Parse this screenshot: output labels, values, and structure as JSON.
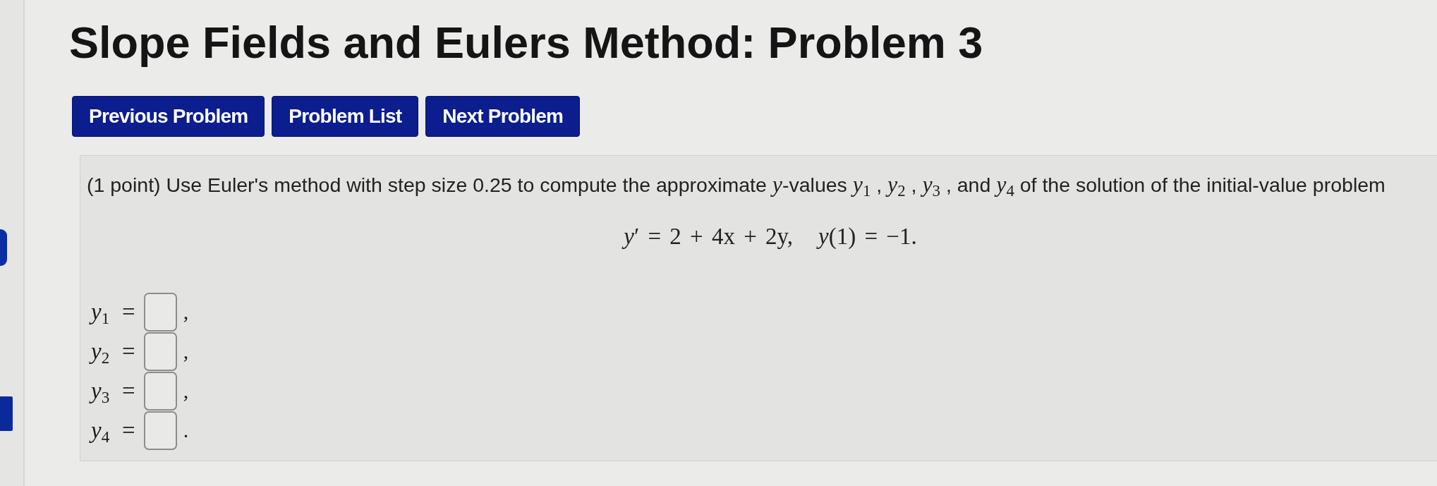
{
  "title": "Slope Fields and Eulers Method: Problem 3",
  "nav_buttons": [
    "Previous Problem",
    "Problem List",
    "Next Problem"
  ],
  "problem": {
    "text": "(1 point) Use Euler's method with step size 0.25 to compute the approximate *y*-values *y*$_{1}$ , *y*$_{2}$ , *y*$_{3}$ , and *y*$_{4}$  of the solution of the initial-value problem",
    "equation": [
      "*y*′ = 2 + 4x + 2y,",
      "*y*(1) = −1."
    ],
    "answers": [
      {
        "label": "*y*$_{1}$",
        "relation": "=",
        "end": ","
      },
      {
        "label": "*y*$_{2}$",
        "relation": "=",
        "end": ","
      },
      {
        "label": "*y*$_{3}$",
        "relation": "=",
        "end": ","
      },
      {
        "label": "*y*$_{4}$",
        "relation": "=",
        "end": "."
      }
    ]
  }
}
